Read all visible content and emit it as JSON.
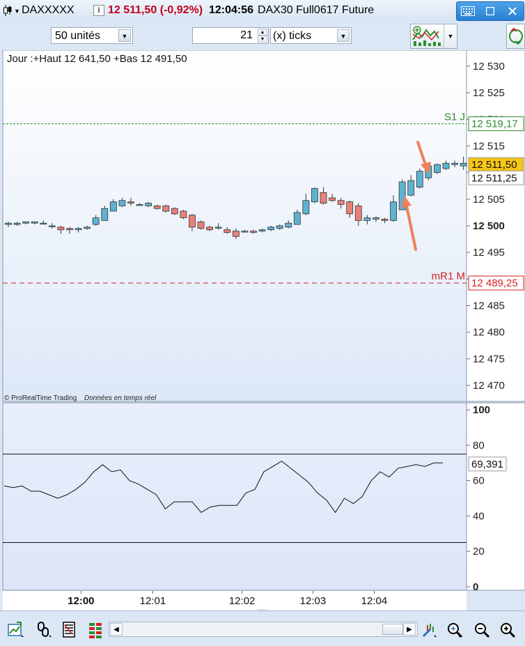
{
  "titlebar": {
    "symbol": "DAXXXXX",
    "info_icon": "i",
    "price_change": "12 511,50 (-0,92%)",
    "time": "12:04:56",
    "instrument": "DAX30 Full0617 Future",
    "icons": [
      "candlestick-icon",
      "keyboard-icon",
      "restore-icon",
      "close-icon"
    ],
    "colors": {
      "price_change": "#c0001a"
    }
  },
  "toolbar": {
    "units": "50 unités",
    "spinner_value": "21",
    "timeframe": "(x) ticks"
  },
  "price_panel": {
    "info": "Jour :+Haut 12 641,50 +Bas 12 491,50",
    "credit": "© ProRealTime Trading",
    "credit_note": "Données en temps réel"
  },
  "chart_data": [
    {
      "type": "candlestick",
      "ylim": [
        12467,
        12533
      ],
      "y_ticks": [
        "12 530",
        "12 525",
        "12 520",
        "12 515",
        "12 510",
        "12 505",
        "12 500",
        "12 495",
        "12 490",
        "12 485",
        "12 480",
        "12 475",
        "12 470"
      ],
      "bold_tick": "12 500",
      "x_ticks": [
        {
          "label": "12:00",
          "bold": true,
          "index": 8.3
        },
        {
          "label": "12:01",
          "bold": false,
          "index": 16.5
        },
        {
          "label": "12:02",
          "bold": false,
          "index": 26.7
        },
        {
          "label": "12:03",
          "bold": false,
          "index": 34.8
        },
        {
          "label": "12:04",
          "bold": false,
          "index": 41.8
        }
      ],
      "candles": [
        {
          "o": 12500.25,
          "h": 12500.75,
          "l": 12499.75,
          "c": 12500.5
        },
        {
          "o": 12500.25,
          "h": 12500.75,
          "l": 12500.0,
          "c": 12500.5
        },
        {
          "o": 12500.5,
          "h": 12500.75,
          "l": 12500.25,
          "c": 12500.75
        },
        {
          "o": 12500.5,
          "h": 12500.75,
          "l": 12500.25,
          "c": 12500.75
        },
        {
          "o": 12500.5,
          "h": 12501.0,
          "l": 12500.25,
          "c": 12500.5
        },
        {
          "o": 12500.0,
          "h": 12500.5,
          "l": 12499.5,
          "c": 12500.0
        },
        {
          "o": 12499.75,
          "h": 12500.0,
          "l": 12498.5,
          "c": 12499.25
        },
        {
          "o": 12499.5,
          "h": 12499.75,
          "l": 12498.5,
          "c": 12499.25
        },
        {
          "o": 12499.25,
          "h": 12499.75,
          "l": 12498.75,
          "c": 12499.5
        },
        {
          "o": 12499.5,
          "h": 12500.0,
          "l": 12499.25,
          "c": 12499.75
        },
        {
          "o": 12500.25,
          "h": 12502.0,
          "l": 12500.0,
          "c": 12501.5
        },
        {
          "o": 12501.0,
          "h": 12503.75,
          "l": 12501.0,
          "c": 12503.25
        },
        {
          "o": 12502.75,
          "h": 12505.0,
          "l": 12502.75,
          "c": 12504.5
        },
        {
          "o": 12503.75,
          "h": 12505.25,
          "l": 12503.5,
          "c": 12504.75
        },
        {
          "o": 12504.5,
          "h": 12505.25,
          "l": 12503.75,
          "c": 12504.25
        },
        {
          "o": 12504.0,
          "h": 12504.25,
          "l": 12503.75,
          "c": 12504.0
        },
        {
          "o": 12503.75,
          "h": 12504.5,
          "l": 12503.5,
          "c": 12504.25
        },
        {
          "o": 12503.75,
          "h": 12504.0,
          "l": 12503.0,
          "c": 12503.25
        },
        {
          "o": 12503.75,
          "h": 12504.0,
          "l": 12502.5,
          "c": 12502.75
        },
        {
          "o": 12503.25,
          "h": 12503.5,
          "l": 12502.0,
          "c": 12502.25
        },
        {
          "o": 12502.75,
          "h": 12503.0,
          "l": 12501.25,
          "c": 12501.5
        },
        {
          "o": 12502.0,
          "h": 12502.25,
          "l": 12499.0,
          "c": 12499.75
        },
        {
          "o": 12500.75,
          "h": 12501.0,
          "l": 12499.25,
          "c": 12499.5
        },
        {
          "o": 12499.75,
          "h": 12500.0,
          "l": 12499.0,
          "c": 12499.25
        },
        {
          "o": 12499.75,
          "h": 12500.5,
          "l": 12499.25,
          "c": 12499.75
        },
        {
          "o": 12499.25,
          "h": 12499.75,
          "l": 12498.5,
          "c": 12498.75
        },
        {
          "o": 12499.0,
          "h": 12499.5,
          "l": 12497.5,
          "c": 12498.0
        },
        {
          "o": 12499.0,
          "h": 12499.25,
          "l": 12498.75,
          "c": 12499.0
        },
        {
          "o": 12499.0,
          "h": 12499.25,
          "l": 12498.5,
          "c": 12498.75
        },
        {
          "o": 12499.0,
          "h": 12499.5,
          "l": 12498.75,
          "c": 12499.25
        },
        {
          "o": 12499.25,
          "h": 12500.0,
          "l": 12499.0,
          "c": 12499.75
        },
        {
          "o": 12499.5,
          "h": 12500.25,
          "l": 12499.25,
          "c": 12500.0
        },
        {
          "o": 12499.75,
          "h": 12501.0,
          "l": 12499.5,
          "c": 12500.5
        },
        {
          "o": 12500.25,
          "h": 12503.0,
          "l": 12500.25,
          "c": 12502.5
        },
        {
          "o": 12502.25,
          "h": 12506.0,
          "l": 12502.0,
          "c": 12504.75
        },
        {
          "o": 12504.5,
          "h": 12507.25,
          "l": 12504.25,
          "c": 12507.0
        },
        {
          "o": 12506.25,
          "h": 12507.25,
          "l": 12504.0,
          "c": 12504.25
        },
        {
          "o": 12505.25,
          "h": 12506.0,
          "l": 12504.5,
          "c": 12504.75
        },
        {
          "o": 12504.75,
          "h": 12505.25,
          "l": 12503.25,
          "c": 12504.0
        },
        {
          "o": 12504.5,
          "h": 12504.75,
          "l": 12501.5,
          "c": 12502.25
        },
        {
          "o": 12503.75,
          "h": 12504.25,
          "l": 12500.0,
          "c": 12501.0
        },
        {
          "o": 12501.0,
          "h": 12502.0,
          "l": 12500.25,
          "c": 12501.5
        },
        {
          "o": 12501.25,
          "h": 12501.75,
          "l": 12500.75,
          "c": 12501.5
        },
        {
          "o": 12501.25,
          "h": 12501.5,
          "l": 12500.5,
          "c": 12501.0
        },
        {
          "o": 12501.0,
          "h": 12505.75,
          "l": 12500.75,
          "c": 12504.5
        },
        {
          "o": 12503.0,
          "h": 12508.75,
          "l": 12503.0,
          "c": 12508.25
        },
        {
          "o": 12505.75,
          "h": 12509.5,
          "l": 12505.5,
          "c": 12508.5
        },
        {
          "o": 12507.25,
          "h": 12510.75,
          "l": 12507.0,
          "c": 12510.25
        },
        {
          "o": 12509.0,
          "h": 12511.5,
          "l": 12508.5,
          "c": 12511.25
        },
        {
          "o": 12510.0,
          "h": 12511.75,
          "l": 12509.75,
          "c": 12511.5
        },
        {
          "o": 12510.75,
          "h": 12512.25,
          "l": 12510.5,
          "c": 12511.75
        },
        {
          "o": 12511.5,
          "h": 12512.25,
          "l": 12511.0,
          "c": 12511.75
        },
        {
          "o": 12511.25,
          "h": 12513.0,
          "l": 12510.5,
          "c": 12511.75
        },
        {
          "o": 12511.75,
          "h": 12512.75,
          "l": 12511.5,
          "c": 12512.5
        }
      ],
      "levels": [
        {
          "label": "S1 J",
          "value": 12519.17,
          "tag": "12 519,17",
          "color": "#2e8b2e",
          "style": "dotted"
        },
        {
          "label": "mR1 M",
          "value": 12489.25,
          "tag": "12 489,25",
          "color": "#d61f1f",
          "style": "dashed"
        }
      ],
      "price_tags": [
        {
          "tag": "12 511,50",
          "value": 12511.5,
          "bg": "#f5c518"
        },
        {
          "tag": "12 511,25",
          "value": 12509.0,
          "bg": "#ffffff"
        }
      ],
      "annotations": [
        "arrow-down-icon",
        "arrow-up-icon"
      ],
      "colors": {
        "up": "#5fb2d1",
        "down": "#e8817a",
        "arrow": "#f07f5a",
        "bg_top": "#ffffff",
        "bg_bottom": "#dde8f7"
      }
    },
    {
      "type": "line",
      "ylim": [
        -2,
        104
      ],
      "y_ticks": [
        "100",
        "80",
        "60",
        "40",
        "20",
        "0"
      ],
      "bold_ticks": [
        "100",
        "0"
      ],
      "hlines": [
        75,
        25
      ],
      "last_label": "69,391",
      "last_value": 69.391,
      "values": [
        57,
        56,
        57,
        54,
        54,
        52,
        50,
        52,
        55,
        59,
        65,
        69,
        65,
        66,
        60,
        58,
        55,
        52,
        44,
        48,
        48,
        48,
        42,
        45,
        46,
        46,
        46,
        53,
        55,
        65,
        68,
        71,
        67,
        63,
        59,
        53,
        49,
        42,
        50,
        47,
        51,
        60,
        65,
        62,
        67,
        68,
        69,
        68,
        70,
        70
      ]
    }
  ],
  "bottombar": {
    "icons": [
      "add-chart-icon",
      "link-icon",
      "list-icon",
      "bricks-icon",
      "scroll-left-icon",
      "scroll-thumb-icon",
      "scroll-right-icon",
      "drawing-tool-icon",
      "zoom-auto-icon",
      "zoom-out-icon",
      "zoom-in-icon"
    ]
  }
}
